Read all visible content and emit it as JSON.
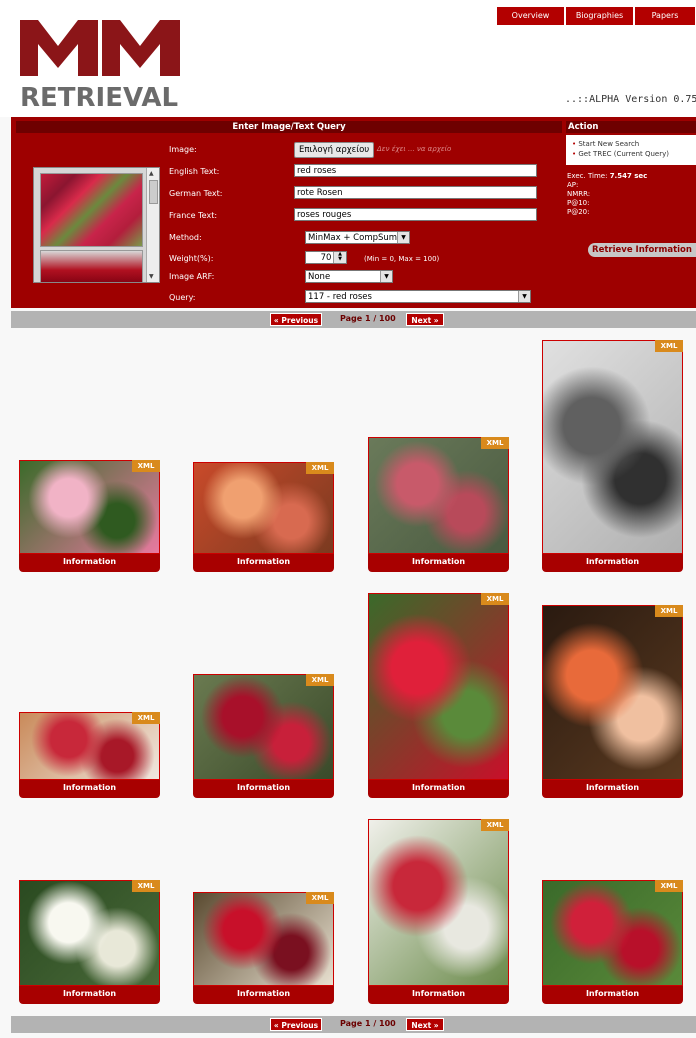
{
  "nav": {
    "items": [
      "Overview",
      "Biographies",
      "Papers"
    ]
  },
  "logo": {
    "text": "RETRIEVAL"
  },
  "version": "..::ALPHA Version 0.75",
  "query": {
    "title": "Enter Image/Text Query",
    "labels": {
      "image": "Image:",
      "english": "English Text:",
      "german": "German Text:",
      "france": "France Text:",
      "method": "Method:",
      "weight": "Weight(%):",
      "arf": "Image ARF:",
      "query": "Query:"
    },
    "file_button": "Επιλογή αρχείου",
    "no_file": "Δεν έχει ... να αρχείο",
    "english_value": "red roses",
    "german_value": "rote Rosen",
    "france_value": "roses rouges",
    "method_value": "MinMax + CompSum",
    "weight_value": "70",
    "weight_range": "(Min = 0, Max = 100)",
    "arf_value": "None",
    "query_value": "117 - red roses"
  },
  "action": {
    "title": "Action",
    "links": [
      "Start New Search",
      "Get TREC (Current Query)"
    ],
    "exec_label": "Exec. Time:",
    "exec_value": "7.547 sec",
    "metrics": [
      "AP:",
      "NMRR:",
      "P@10:",
      "P@20:"
    ],
    "retrieve_button": "Retrieve Information"
  },
  "pager": {
    "prev": "« Previous",
    "page": "Page 1 / 100",
    "next": "Next »"
  },
  "results": {
    "xml_label": "XML",
    "info_label": "Information",
    "images": [
      {
        "icon": "pink-wild-rose-photo-icon",
        "colors": [
          "#3b6b2a",
          "#f1b3c6",
          "#e87aa0",
          "#2f5a20"
        ]
      },
      {
        "icon": "painting-petals-photo-icon",
        "colors": [
          "#c94a2a",
          "#f0a070",
          "#7a3a20",
          "#d86a50"
        ]
      },
      {
        "icon": "painted-roses-photo-icon",
        "colors": [
          "#6a7a5a",
          "#c85a6a",
          "#4a5a40",
          "#b84a5a"
        ]
      },
      {
        "icon": "engraving-figures-photo-icon",
        "colors": [
          "#e0e0e0",
          "#606060",
          "#b0b0b0",
          "#303030"
        ]
      },
      {
        "icon": "red-berries-bowls-photo-icon",
        "colors": [
          "#c98a5a",
          "#c8283a",
          "#f0e8e0",
          "#a81828"
        ]
      },
      {
        "icon": "dark-red-rose-photo-icon",
        "colors": [
          "#6a7a50",
          "#a8102a",
          "#3a4a2a",
          "#c8203a"
        ]
      },
      {
        "icon": "red-roses-bush-photo-icon",
        "colors": [
          "#3a6a2a",
          "#e0203a",
          "#c8102a",
          "#5a8a3a"
        ]
      },
      {
        "icon": "flower-still-life-photo-icon",
        "colors": [
          "#2a1a10",
          "#e86a3a",
          "#5a3a20",
          "#f0c0a0"
        ]
      },
      {
        "icon": "white-roses-photo-icon",
        "colors": [
          "#2a4a20",
          "#f8f8f0",
          "#4a6a3a",
          "#e8e8d8"
        ]
      },
      {
        "icon": "red-rose-baby-breath-photo-icon",
        "colors": [
          "#5a4a30",
          "#c8102a",
          "#e8e0d0",
          "#7a1020"
        ]
      },
      {
        "icon": "rose-hips-branch-photo-icon",
        "colors": [
          "#f0f0ea",
          "#c8283a",
          "#6a8a4a",
          "#e8e8e0"
        ]
      },
      {
        "icon": "red-rose-hips-photo-icon",
        "colors": [
          "#3a6a2a",
          "#d0203a",
          "#5a8a3a",
          "#b8102a"
        ]
      }
    ]
  }
}
